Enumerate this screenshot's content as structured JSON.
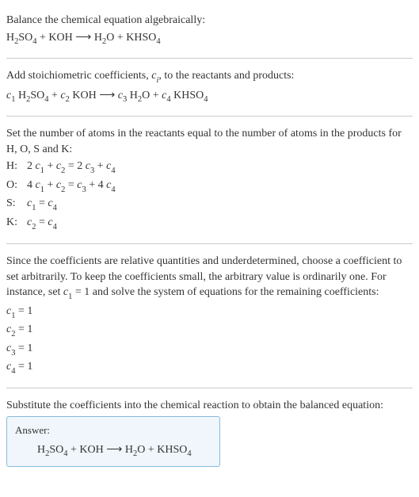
{
  "intro": {
    "line1": "Balance the chemical equation algebraically:",
    "eq_h2so4": "H",
    "eq_2": "2",
    "eq_so4": "SO",
    "eq_4": "4",
    "eq_plus": " + KOH ",
    "eq_arrow": "⟶",
    "eq_h2o": " H",
    "eq_o": "O + KHSO"
  },
  "step1": {
    "text_a": "Add stoichiometric coefficients, ",
    "ci": "c",
    "ci_sub": "i",
    "text_b": ", to the reactants and products:",
    "c1": "c",
    "sub1": "1",
    "sp1": " H",
    "sub2": "2",
    "so4": "SO",
    "sub4": "4",
    "plus1": " + ",
    "c2": "c",
    "csub2": "2",
    "koh": " KOH ",
    "arrow": "⟶",
    "sp2": " ",
    "c3": "c",
    "csub3": "3",
    "h2o_h": " H",
    "h2o_2": "2",
    "h2o_o": "O + ",
    "c4": "c",
    "csub4": "4",
    "khso4": " KHSO",
    "khso4_4": "4"
  },
  "step2": {
    "text1": "Set the number of atoms in the reactants equal to the number of atoms in the products for H, O, S and K:",
    "elements": [
      {
        "label": "H:",
        "lhs_a": "2 ",
        "c1": "c",
        "s1": "1",
        "plus": " + ",
        "c2": "c",
        "s2": "2",
        "eq": " = 2 ",
        "c3": "c",
        "s3": "3",
        "plus2": " + ",
        "c4": "c",
        "s4": "4"
      },
      {
        "label": "O:",
        "lhs_a": "4 ",
        "c1": "c",
        "s1": "1",
        "plus": " + ",
        "c2": "c",
        "s2": "2",
        "eq": " = ",
        "c3": "c",
        "s3": "3",
        "plus2": " + 4 ",
        "c4": "c",
        "s4": "4"
      },
      {
        "label": "S:",
        "lhs_a": "",
        "c1": "c",
        "s1": "1",
        "plus": "",
        "c2": "",
        "s2": "",
        "eq": " = ",
        "c3": "",
        "s3": "",
        "plus2": "",
        "c4": "c",
        "s4": "4"
      },
      {
        "label": "K:",
        "lhs_a": "",
        "c1": "c",
        "s1": "2",
        "plus": "",
        "c2": "",
        "s2": "",
        "eq": " = ",
        "c3": "",
        "s3": "",
        "plus2": "",
        "c4": "c",
        "s4": "4"
      }
    ]
  },
  "step3": {
    "text1": "Since the coefficients are relative quantities and underdetermined, choose a coefficient to set arbitrarily. To keep the coefficients small, the arbitrary value is ordinarily one. For instance, set ",
    "c1": "c",
    "s1": "1",
    "text2": " = 1 and solve the system of equations for the remaining coefficients:",
    "results": [
      {
        "c": "c",
        "sub": "1",
        "val": " = 1"
      },
      {
        "c": "c",
        "sub": "2",
        "val": " = 1"
      },
      {
        "c": "c",
        "sub": "3",
        "val": " = 1"
      },
      {
        "c": "c",
        "sub": "4",
        "val": " = 1"
      }
    ]
  },
  "step4": {
    "text": "Substitute the coefficients into the chemical reaction to obtain the balanced equation:"
  },
  "answer": {
    "title": "Answer:",
    "h": "H",
    "sub2": "2",
    "so": "SO",
    "sub4": "4",
    "plus": " + KOH ",
    "arrow": "⟶",
    "h2": " H",
    "sub2b": "2",
    "o_plus": "O + KHSO",
    "sub4b": "4"
  }
}
